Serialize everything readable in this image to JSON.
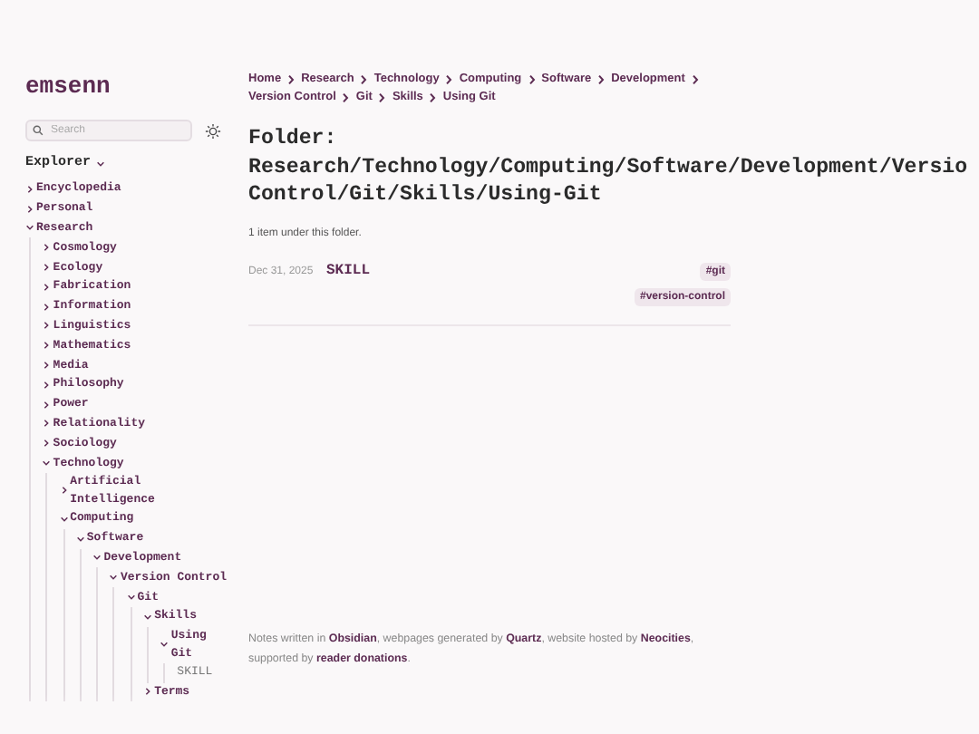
{
  "sidebar": {
    "site_title": "emsenn",
    "search": {
      "placeholder": "Search"
    },
    "explorer": {
      "label": "Explorer",
      "expanded": true
    },
    "tree": [
      {
        "label": "Encyclopedia",
        "kind": "folder",
        "expanded": false
      },
      {
        "label": "Personal",
        "kind": "folder",
        "expanded": false
      },
      {
        "label": "Research",
        "kind": "folder",
        "expanded": true,
        "children": [
          {
            "label": "Cosmology",
            "kind": "folder",
            "expanded": false
          },
          {
            "label": "Ecology",
            "kind": "folder",
            "expanded": false
          },
          {
            "label": "Fabrication",
            "kind": "folder",
            "expanded": false
          },
          {
            "label": "Information",
            "kind": "folder",
            "expanded": false
          },
          {
            "label": "Linguistics",
            "kind": "folder",
            "expanded": false
          },
          {
            "label": "Mathematics",
            "kind": "folder",
            "expanded": false
          },
          {
            "label": "Media",
            "kind": "folder",
            "expanded": false
          },
          {
            "label": "Philosophy",
            "kind": "folder",
            "expanded": false
          },
          {
            "label": "Power",
            "kind": "folder",
            "expanded": false
          },
          {
            "label": "Relationality",
            "kind": "folder",
            "expanded": false
          },
          {
            "label": "Sociology",
            "kind": "folder",
            "expanded": false
          },
          {
            "label": "Technology",
            "kind": "folder",
            "expanded": true,
            "children": [
              {
                "label": "Artificial Intelligence",
                "kind": "folder",
                "expanded": false
              },
              {
                "label": "Computing",
                "kind": "folder",
                "expanded": true,
                "children": [
                  {
                    "label": "Software",
                    "kind": "folder",
                    "expanded": true,
                    "children": [
                      {
                        "label": "Development",
                        "kind": "folder",
                        "expanded": true,
                        "children": [
                          {
                            "label": "Version Control",
                            "kind": "folder",
                            "expanded": true,
                            "children": [
                              {
                                "label": "Git",
                                "kind": "folder",
                                "expanded": true,
                                "children": [
                                  {
                                    "label": "Skills",
                                    "kind": "folder",
                                    "expanded": true,
                                    "children": [
                                      {
                                        "label": "Using Git",
                                        "kind": "folder",
                                        "expanded": true,
                                        "children": [
                                          {
                                            "label": "SKILL",
                                            "kind": "file"
                                          }
                                        ]
                                      }
                                    ]
                                  },
                                  {
                                    "label": "Terms",
                                    "kind": "folder",
                                    "expanded": false
                                  }
                                ]
                              }
                            ]
                          }
                        ]
                      }
                    ]
                  }
                ]
              }
            ]
          }
        ]
      }
    ]
  },
  "breadcrumbs": [
    "Home",
    "Research",
    "Technology",
    "Computing",
    "Software",
    "Development",
    "Version Control",
    "Git",
    "Skills",
    "Using Git"
  ],
  "title_lines": [
    "Folder:",
    "Research/Technology/Computing/Software/Development/Versio",
    "Control/Git/Skills/Using-Git"
  ],
  "summary": "1 item under this folder.",
  "items": [
    {
      "date": "Dec 31, 2025",
      "title": "SKILL",
      "tags": [
        "#git",
        "#version-control"
      ]
    }
  ],
  "footer": "Notes written in **Obsidian**, webpages generated by **Quartz**, website hosted by **Neocities**, supported by **reader donations**."
}
